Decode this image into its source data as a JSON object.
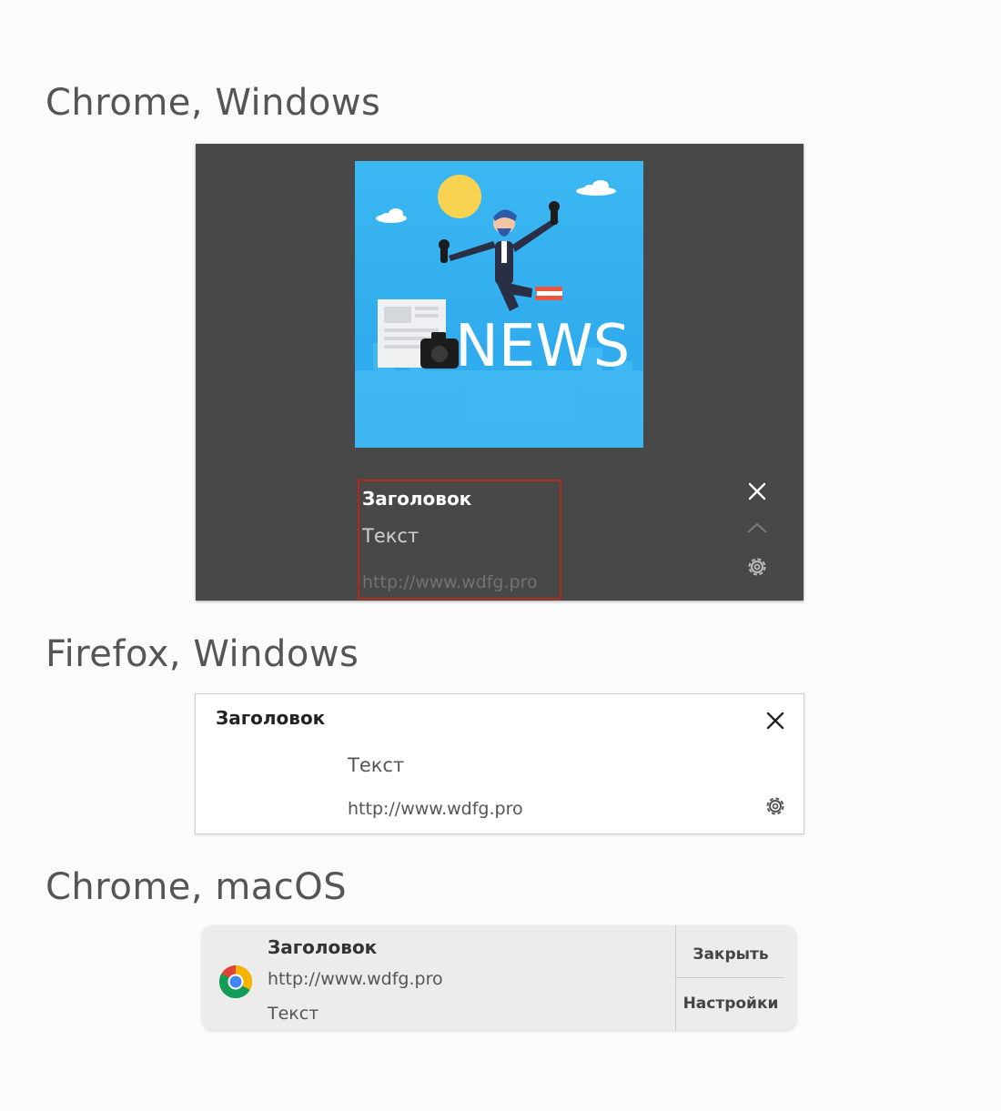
{
  "sections": {
    "chrome_windows": "Chrome, Windows",
    "firefox_windows": "Firefox, Windows",
    "chrome_macos": "Chrome, macOS"
  },
  "chrome_windows_notification": {
    "image_text": "NEWS",
    "title": "Заголовок",
    "body": "Текст",
    "url": "http://www.wdfg.pro",
    "close_icon": "close-icon",
    "collapse_icon": "chevron-up-icon",
    "settings_icon": "gear-icon",
    "highlight_color": "#b02a1c",
    "background_color": "#484848"
  },
  "firefox_windows_notification": {
    "title": "Заголовок",
    "body": "Текст",
    "url": "http://www.wdfg.pro",
    "close_icon": "close-icon",
    "settings_icon": "gear-icon"
  },
  "chrome_macos_notification": {
    "app_icon": "chrome-icon",
    "title": "Заголовок",
    "url": "http://www.wdfg.pro",
    "body": "Текст",
    "close_label": "Закрыть",
    "settings_label": "Настройки"
  }
}
